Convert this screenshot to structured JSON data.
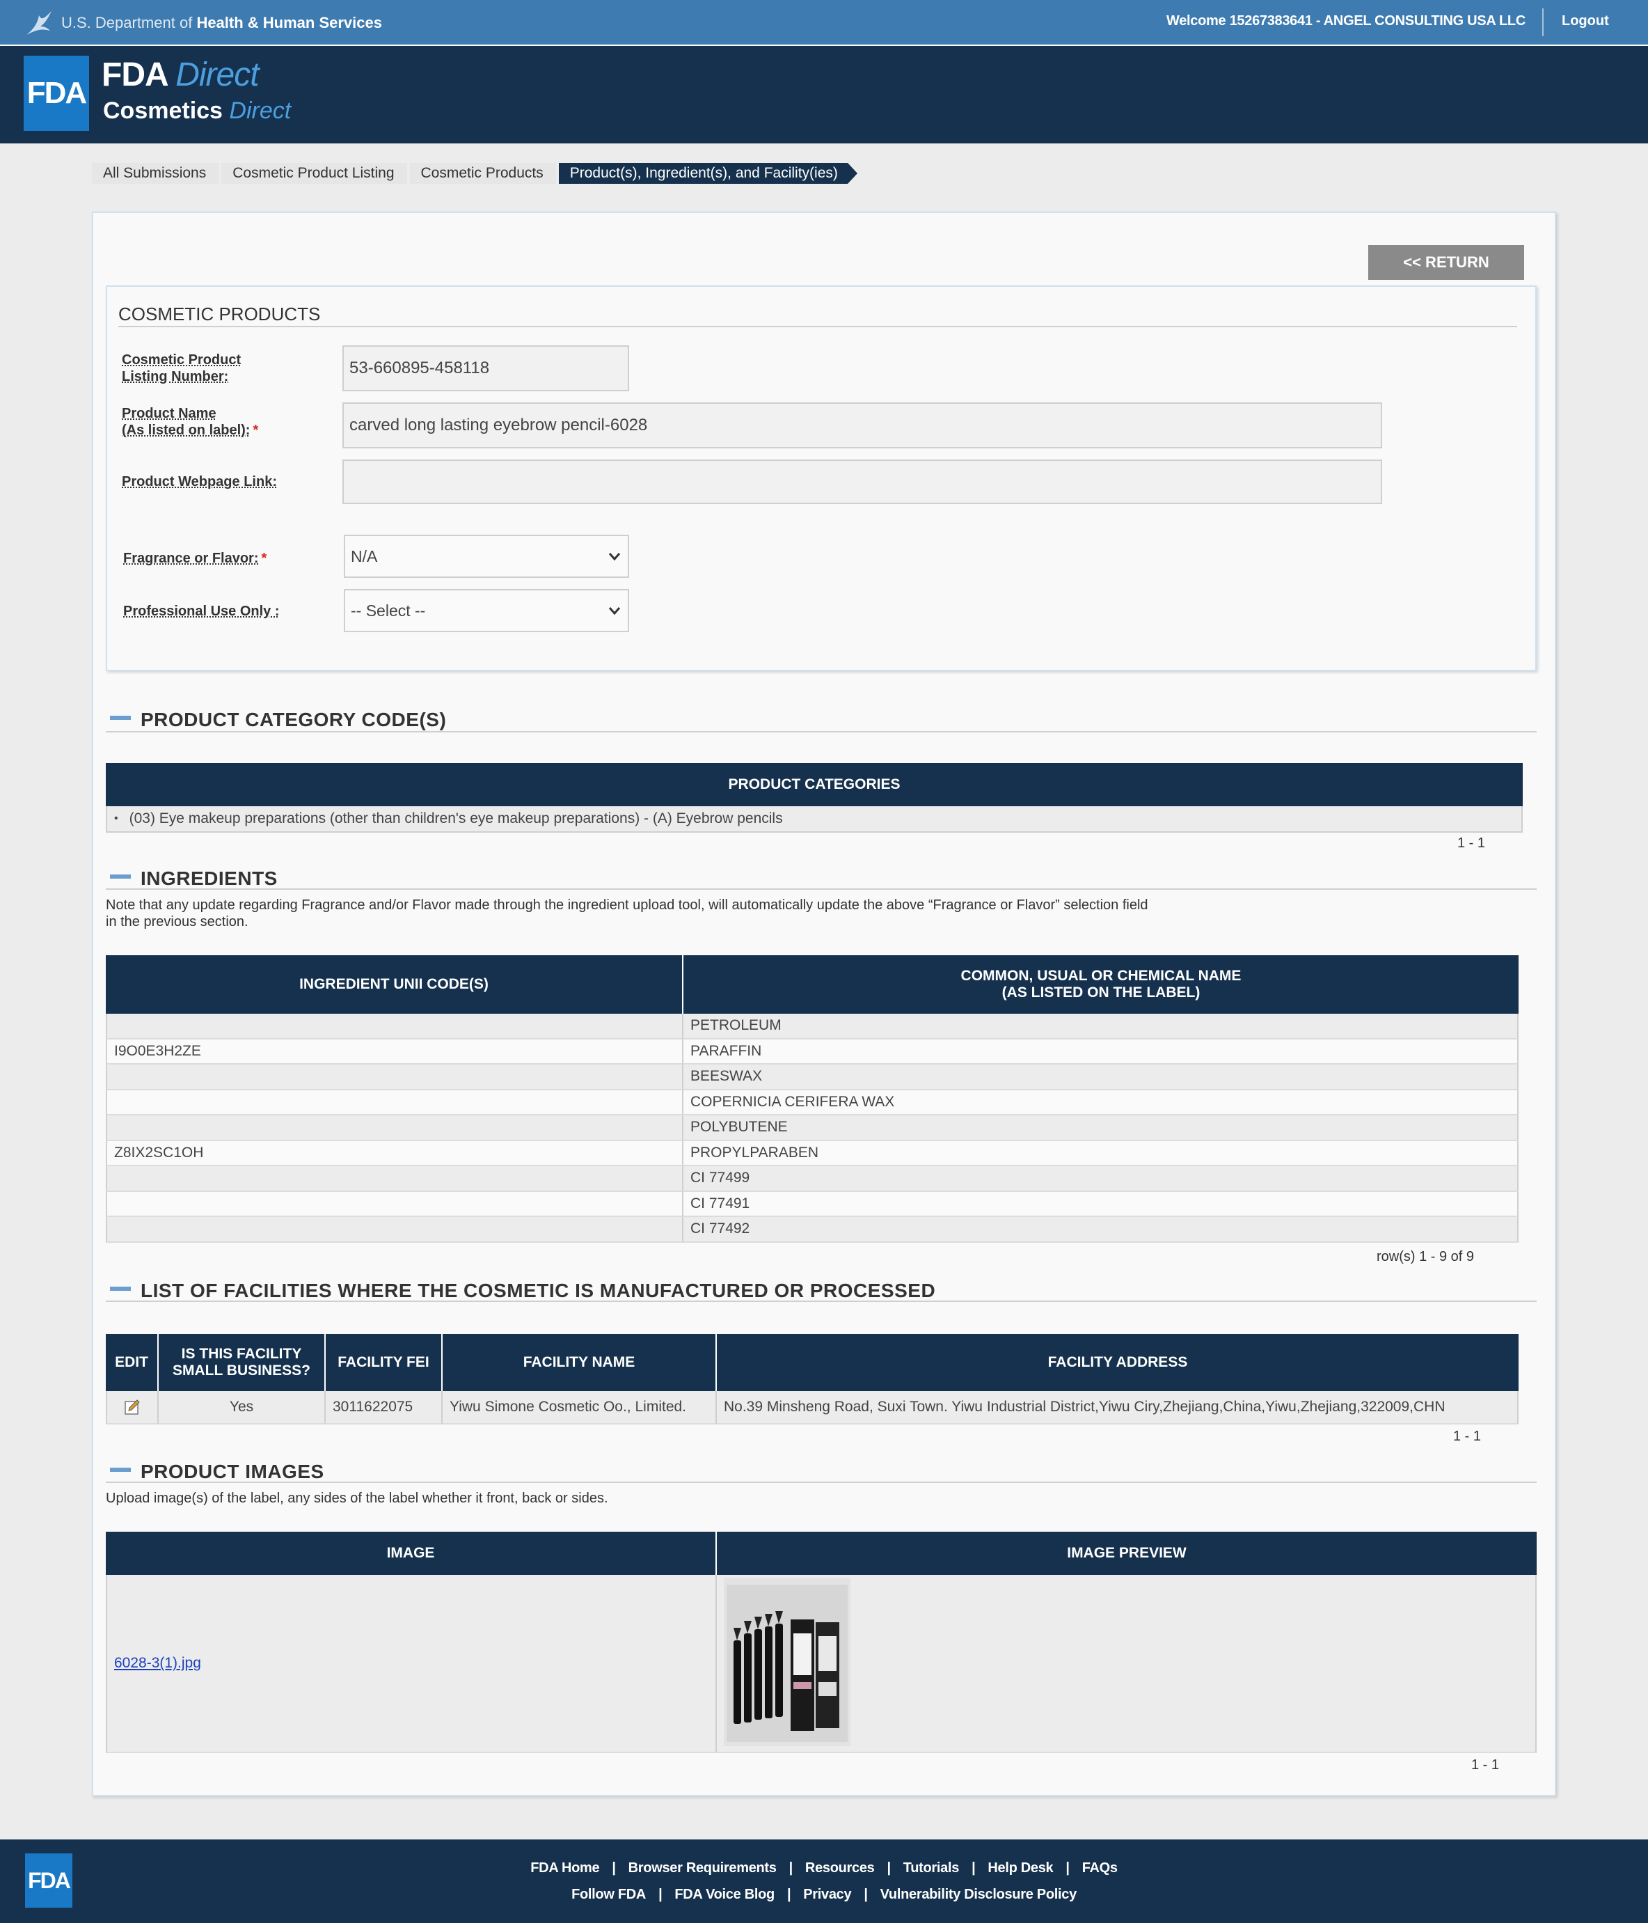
{
  "topbar": {
    "agency_prefix": "U.S. Department of",
    "agency_bold": "Health & Human Services",
    "welcome": "Welcome 15267383641 - ANGEL CONSULTING USA LLC",
    "logout": "Logout"
  },
  "header": {
    "badge": "FDA",
    "brand_fda": "FDA",
    "brand_direct": "Direct",
    "brand_cosmetics": "Cosmetics",
    "brand_cosmetics_direct": "Direct"
  },
  "breadcrumb": [
    {
      "label": "All Submissions"
    },
    {
      "label": "Cosmetic Product Listing"
    },
    {
      "label": "Cosmetic Products"
    },
    {
      "label": "Product(s), Ingredient(s), and Facility(ies)"
    }
  ],
  "return_button": "<< RETURN",
  "cosmetic_products": {
    "title": "COSMETIC PRODUCTS",
    "listing_number_label_1": "Cosmetic Product",
    "listing_number_label_2": "Listing Number:",
    "listing_number": "53-660895-458118",
    "product_name_label_1": "Product Name",
    "product_name_label_2": "(As listed on label):",
    "product_name": "carved long lasting eyebrow pencil-6028",
    "webpage_label": "Product Webpage Link:",
    "webpage": "",
    "fragrance_label": "Fragrance or Flavor:",
    "fragrance_value": "N/A",
    "professional_label": "Professional Use Only :",
    "professional_value": "-- Select --",
    "required_mark": "*"
  },
  "categories": {
    "title": "PRODUCT CATEGORY CODE(S)",
    "header": "PRODUCT CATEGORIES",
    "items": [
      "(03) Eye makeup preparations (other than children's eye makeup preparations) - (A) Eyebrow pencils"
    ],
    "pager": "1 - 1"
  },
  "ingredients": {
    "title": "INGREDIENTS",
    "note_1": "Note that any update regarding Fragrance and/or Flavor made through the ingredient upload tool, will automatically update the above “Fragrance or Flavor” selection field",
    "note_2": "in the previous section.",
    "col1": "INGREDIENT UNII CODE(S)",
    "col2_1": "COMMON, USUAL OR CHEMICAL NAME",
    "col2_2": "(AS LISTED ON THE LABEL)",
    "rows": [
      {
        "unii": "",
        "name": "PETROLEUM"
      },
      {
        "unii": "I9O0E3H2ZE",
        "name": "PARAFFIN"
      },
      {
        "unii": "",
        "name": "BEESWAX"
      },
      {
        "unii": "",
        "name": "COPERNICIA CERIFERA WAX"
      },
      {
        "unii": "",
        "name": "POLYBUTENE"
      },
      {
        "unii": "Z8IX2SC1OH",
        "name": "PROPYLPARABEN"
      },
      {
        "unii": "",
        "name": "CI 77499"
      },
      {
        "unii": "",
        "name": "CI 77491"
      },
      {
        "unii": "",
        "name": "CI 77492"
      }
    ],
    "pager": "row(s) 1 - 9 of 9"
  },
  "facilities": {
    "title": "LIST OF FACILITIES WHERE THE COSMETIC IS MANUFACTURED OR PROCESSED",
    "col_edit": "EDIT",
    "col_small_1": "IS THIS FACILITY",
    "col_small_2": "SMALL BUSINESS?",
    "col_fei": "FACILITY FEI",
    "col_name": "FACILITY NAME",
    "col_address": "FACILITY ADDRESS",
    "rows": [
      {
        "small_business": "Yes",
        "fei": "3011622075",
        "name": "Yiwu Simone Cosmetic Oo., Limited.",
        "address": "No.39 Minsheng Road, Suxi Town. Yiwu Industrial District,Yiwu Ciry,Zhejiang,China,Yiwu,Zhejiang,322009,CHN"
      }
    ],
    "pager": "1 - 1"
  },
  "images": {
    "title": "PRODUCT IMAGES",
    "note": "Upload image(s) of the label, any sides of the label whether it front, back or sides.",
    "col_image": "IMAGE",
    "col_preview": "IMAGE PREVIEW",
    "rows": [
      {
        "file": "6028-3(1).jpg"
      }
    ],
    "pager": "1 - 1"
  },
  "footer": {
    "badge": "FDA",
    "links_row1": [
      "FDA Home",
      "Browser Requirements",
      "Resources",
      "Tutorials",
      "Help Desk",
      "FAQs"
    ],
    "links_row2": [
      "Follow FDA",
      "FDA Voice Blog",
      "Privacy",
      "Vulnerability Disclosure Policy"
    ],
    "separator": "|"
  },
  "colors": {
    "topbar": "#3d7bb0",
    "navy": "#15314d",
    "fda_blue": "#1a79c6",
    "required": "#d9261c",
    "link": "#1a3fbf"
  }
}
